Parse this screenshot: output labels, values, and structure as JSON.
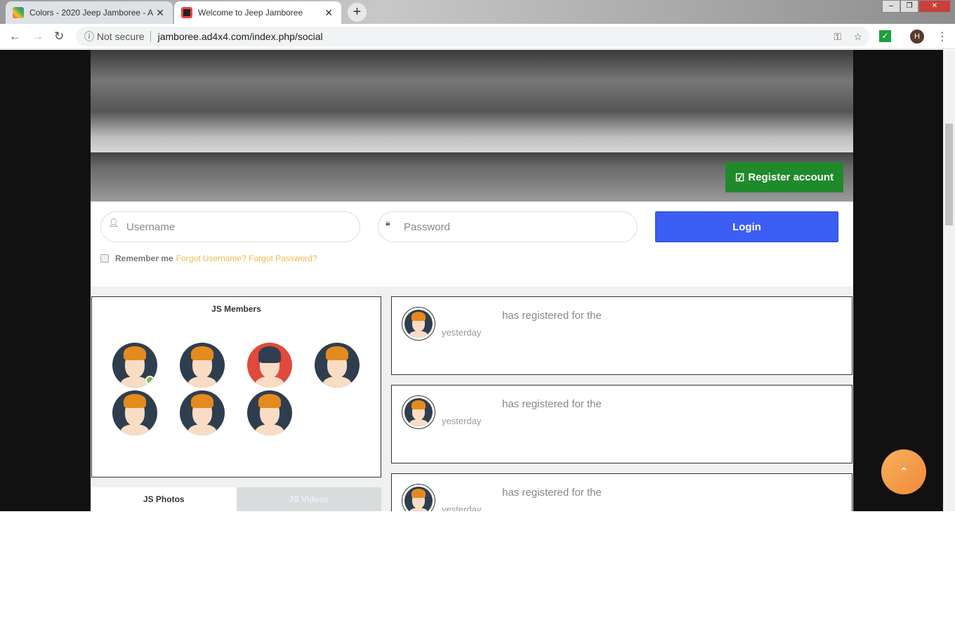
{
  "browser": {
    "tabs": [
      {
        "title": "Colors - 2020 Jeep Jamboree - A"
      },
      {
        "title": "Welcome to Jeep Jamboree"
      }
    ],
    "security": "Not secure",
    "url": "jamboree.ad4x4.com/index.php/social",
    "profile_initial": "H"
  },
  "banner": {
    "register_label": "Register account"
  },
  "login": {
    "username_placeholder": "Username",
    "password_placeholder": "Password",
    "login_label": "Login",
    "remember_label": "Remember me",
    "forgot_username": "Forgot Username?",
    "forgot_password": "Forgot Password?"
  },
  "members": {
    "title": "JS Members",
    "count": 7
  },
  "media_tabs": [
    {
      "label": "JS Photos"
    },
    {
      "label": "JS Videos"
    }
  ],
  "activity": [
    {
      "text": "has registered for the",
      "time": "yesterday"
    },
    {
      "text": "has registered for the",
      "time": "yesterday"
    },
    {
      "text": "has registered for the",
      "time": "yesterday"
    }
  ],
  "colors": {
    "register": "#1f8a2a",
    "login": "#3d5ef5",
    "link": "#f0b84a"
  }
}
